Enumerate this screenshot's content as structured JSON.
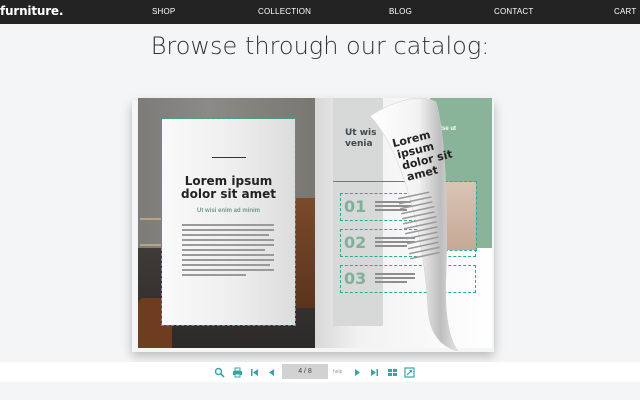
{
  "header": {
    "logo": "furniture",
    "logo_dot": ".",
    "nav": [
      "SHOP",
      "COLLECTION",
      "BLOG",
      "CONTACT",
      "CART"
    ]
  },
  "main": {
    "heading": "Browse through our catalog:"
  },
  "catalog": {
    "left_page": {
      "title_line1": "Lorem ipsum",
      "title_line2": "dolor sit amet",
      "subtitle": "Ut wisi enim ad minim"
    },
    "right_page": {
      "title_line1": "Ut wis",
      "title_line2": "venia",
      "numbers": [
        "01",
        "02",
        "03"
      ],
      "green_text": "mise ut"
    },
    "curl_page": {
      "title_line1": "Lorem",
      "title_line2": "ipsum",
      "title_line3": "dolor sit",
      "title_line4": "amet"
    }
  },
  "viewer": {
    "page_indicator": "4 / 8",
    "small_label": "help",
    "colors": {
      "accent": "#34a6a6",
      "nav_bg": "#232323"
    }
  }
}
